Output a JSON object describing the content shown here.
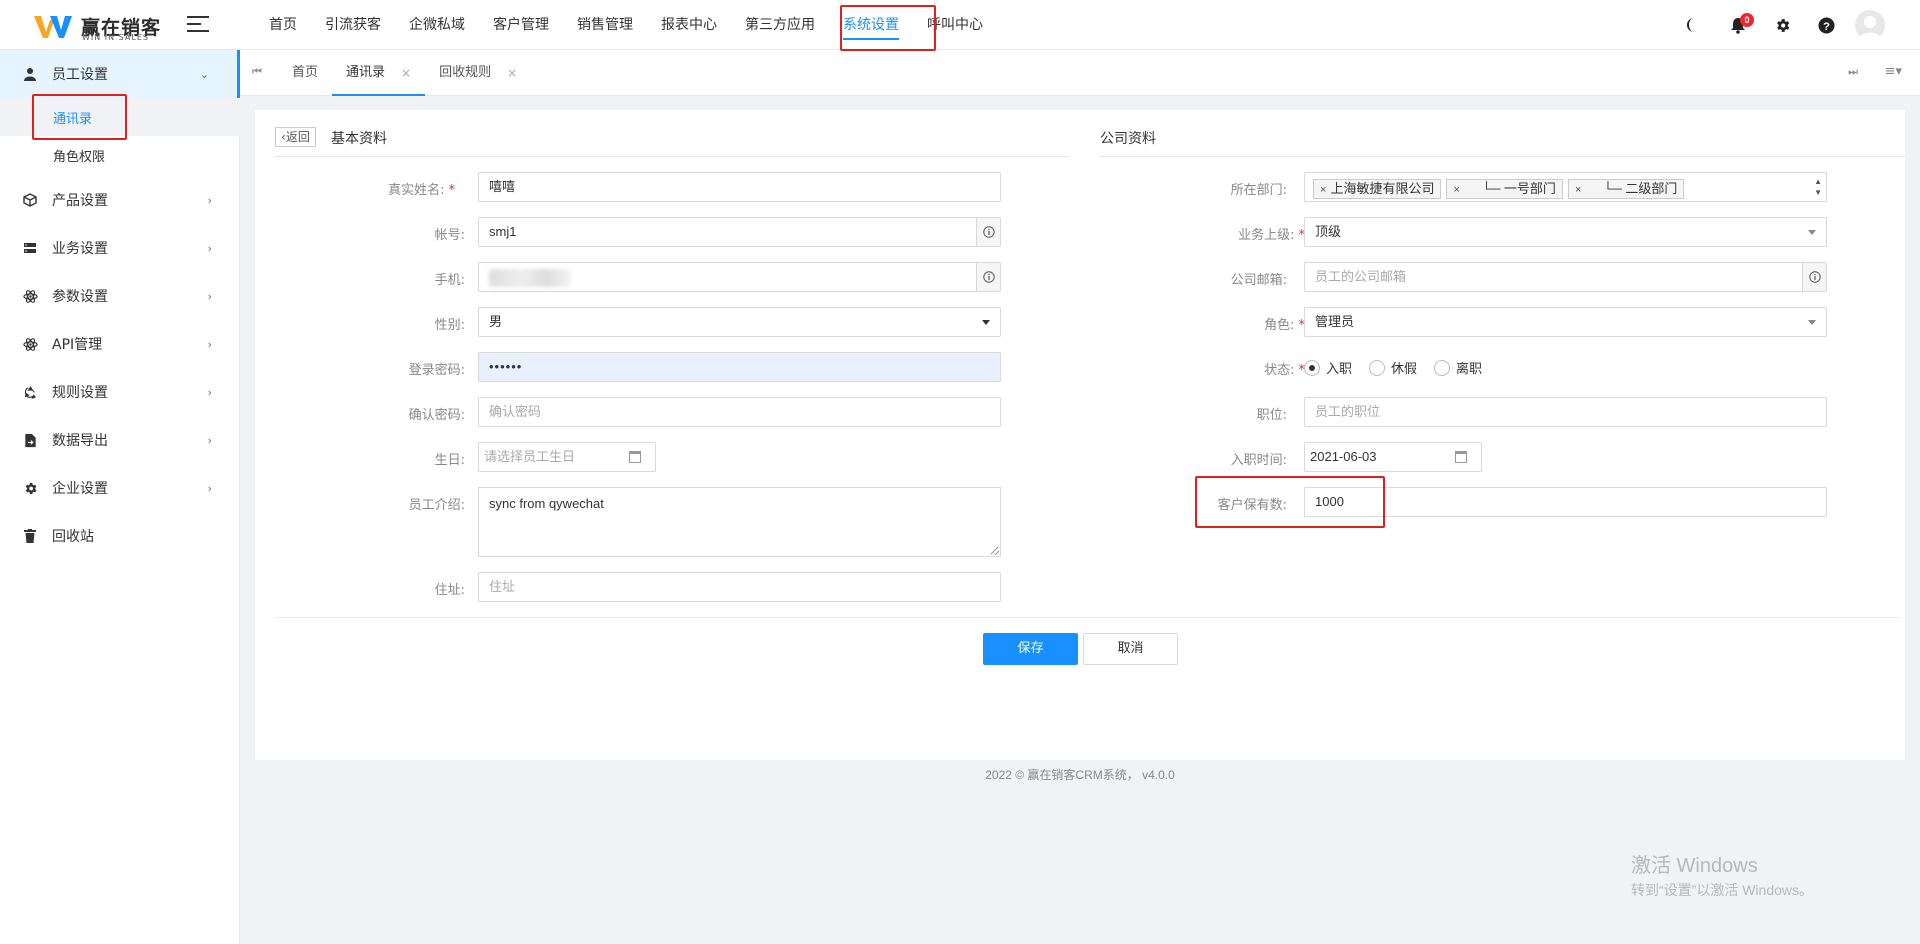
{
  "app": {
    "logo_title": "赢在销客",
    "logo_subtitle": "WIN IN SALES"
  },
  "topnav": {
    "items": [
      {
        "label": "首页"
      },
      {
        "label": "引流获客"
      },
      {
        "label": "企微私域"
      },
      {
        "label": "客户管理"
      },
      {
        "label": "销售管理"
      },
      {
        "label": "报表中心"
      },
      {
        "label": "第三方应用"
      },
      {
        "label": "系统设置",
        "active": true
      },
      {
        "label": "呼叫中心"
      }
    ]
  },
  "header": {
    "icons": [
      "moon-icon",
      "bell-icon",
      "gear-icon",
      "help-icon",
      "user-avatar-icon"
    ],
    "notification_count": "0"
  },
  "sidebar": {
    "items": [
      {
        "label": "员工设置",
        "icon": "user-icon",
        "open": true
      },
      {
        "label": "产品设置",
        "icon": "cube-icon"
      },
      {
        "label": "业务设置",
        "icon": "server-icon"
      },
      {
        "label": "参数设置",
        "icon": "atom-icon"
      },
      {
        "label": "API管理",
        "icon": "atom-icon"
      },
      {
        "label": "规则设置",
        "icon": "recycle-icon"
      },
      {
        "label": "数据导出",
        "icon": "file-export-icon"
      },
      {
        "label": "企业设置",
        "icon": "gear-icon"
      },
      {
        "label": "回收站",
        "icon": "trash-icon"
      }
    ],
    "subitems": [
      {
        "label": "通讯录",
        "active": true
      },
      {
        "label": "角色权限"
      }
    ]
  },
  "tabs": {
    "items": [
      {
        "label": "首页",
        "closable": false
      },
      {
        "label": "通讯录",
        "closable": true,
        "active": true
      },
      {
        "label": "回收规则",
        "closable": true
      }
    ],
    "close_glyph": "×"
  },
  "form": {
    "back_label": "返回",
    "basic_title": "基本资料",
    "company_title": "公司资料",
    "left": {
      "real_name": {
        "label": "真实姓名:",
        "value": "嘻嘻"
      },
      "account": {
        "label": "帐号:",
        "value": "smj1"
      },
      "phone": {
        "label": "手机:",
        "value": ""
      },
      "gender": {
        "label": "性别:",
        "value": "男"
      },
      "password": {
        "label": "登录密码:",
        "value": "••••••"
      },
      "confirm_password": {
        "label": "确认密码:",
        "placeholder": "确认密码"
      },
      "birthday": {
        "label": "生日:",
        "placeholder": "请选择员工生日"
      },
      "intro": {
        "label": "员工介绍:",
        "value": "sync from qywechat"
      },
      "address": {
        "label": "住址:",
        "placeholder": "住址"
      }
    },
    "right": {
      "department": {
        "label": "所在部门:",
        "tags": [
          "上海敏捷有限公司",
          "└─ 一号部门",
          "└─ 二级部门"
        ]
      },
      "superior": {
        "label": "业务上级:",
        "value": "顶级"
      },
      "email": {
        "label": "公司邮箱:",
        "placeholder": "员工的公司邮箱"
      },
      "role": {
        "label": "角色:",
        "value": "管理员"
      },
      "status": {
        "label": "状态:",
        "options": [
          "入职",
          "休假",
          "离职"
        ],
        "selected": "入职"
      },
      "position": {
        "label": "职位:",
        "placeholder": "员工的职位"
      },
      "hire_date": {
        "label": "入职时间:",
        "value": "2021-06-03"
      },
      "customer_limit": {
        "label": "客户保有数:",
        "value": "1000"
      }
    },
    "save_label": "保存",
    "cancel_label": "取消"
  },
  "footer": {
    "text": "2022 © 赢在销客CRM系统， v4.0.0"
  },
  "watermark": {
    "line1": "激活 Windows",
    "line2": "转到“设置”以激活 Windows。"
  }
}
